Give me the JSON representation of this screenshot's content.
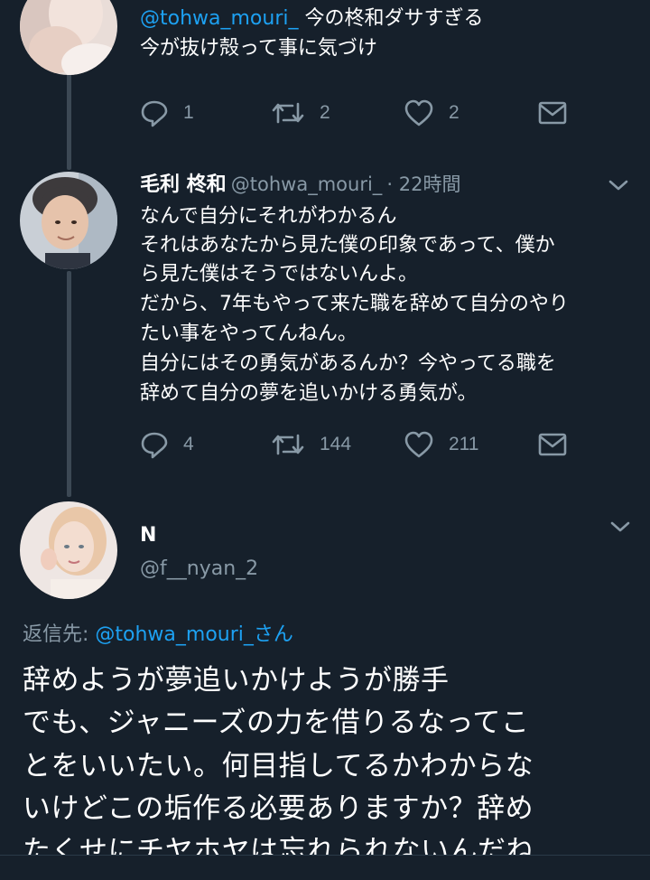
{
  "tweet1": {
    "text_lines": [
      "@tohwa_mouri_ 今の柊和ダサすぎる",
      "今が抜け殻って事に気づけ"
    ],
    "mention": "@tohwa_mouri_",
    "after_mention": " 今の柊和ダサすぎる",
    "actions": {
      "reply_count": "1",
      "retweet_count": "2",
      "like_count": "2"
    }
  },
  "tweet2": {
    "display_name": "毛利 柊和",
    "handle": "@tohwa_mouri_",
    "time": "· 22時間",
    "text_lines": [
      "なんで自分にそれがわかるん",
      "それはあなたから見た僕の印象であって、僕か",
      "ら見た僕はそうではないんよ。",
      "だから、7年もやって来た職を辞めて自分のやり",
      "たい事をやってんねん。",
      "自分にはその勇気があるんか？今やってる職を",
      "辞めて自分の夢を追いかける勇気が。"
    ],
    "actions": {
      "reply_count": "4",
      "retweet_count": "144",
      "like_count": "211"
    }
  },
  "tweet3": {
    "display_name": "N",
    "handle": "@f__nyan_2",
    "reply_to_prefix": "返信先: ",
    "reply_to_user": "@tohwa_mouri_さん",
    "text_lines": [
      "辞めようが夢追いかけようが勝手",
      "でも、ジャニーズの力を借りるなってこ",
      "とをいいたい。何目指してるかわからな",
      "いけどこの垢作る必要ありますか？辞め",
      "たくせにチヤホヤは忘れられないんだね"
    ]
  },
  "colors": {
    "background": "#16202b",
    "accent": "#1da1f2",
    "muted": "#8899a6",
    "thread_line": "#3c4854"
  },
  "icons": [
    "reply-icon",
    "retweet-icon",
    "like-icon",
    "message-icon",
    "chevron-down-icon"
  ]
}
